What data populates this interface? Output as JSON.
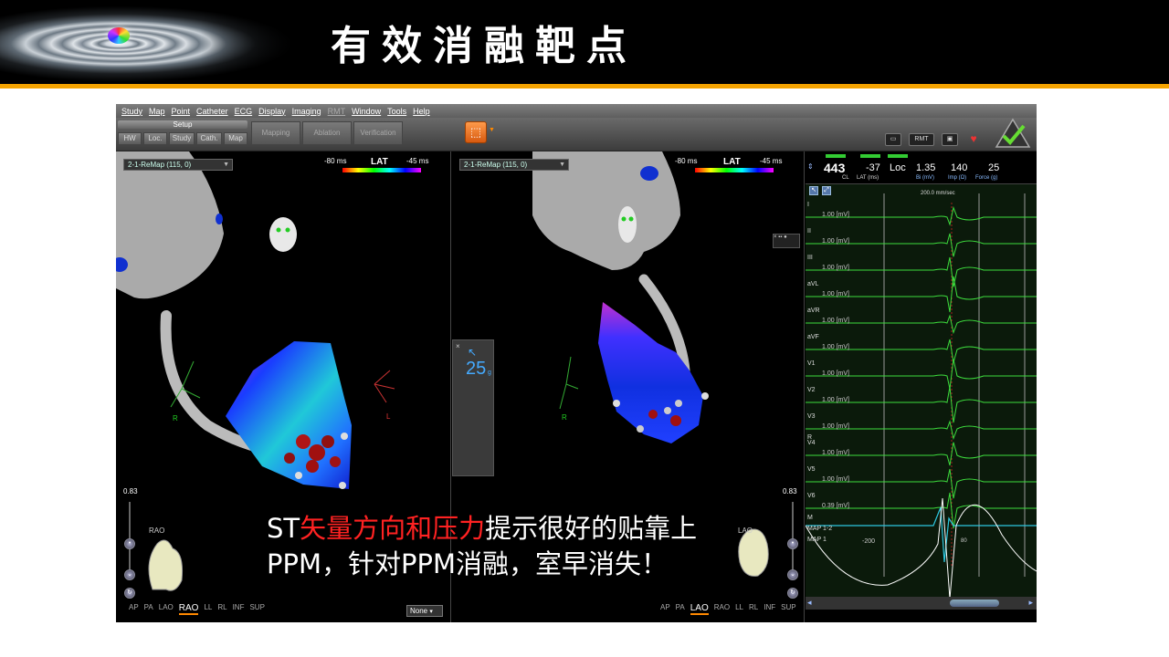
{
  "slide": {
    "title": "有效消融靶点",
    "caption": {
      "line1_prefix": "ST",
      "line1_red": "矢量方向和压力",
      "line1_suffix": "提示很好的贴靠上",
      "line2": "PPM，针对PPM消融，室早消失！"
    }
  },
  "app": {
    "menu": [
      "Study",
      "Map",
      "Point",
      "Catheter",
      "ECG",
      "Display",
      "Imaging",
      "RMT",
      "Window",
      "Tools",
      "Help"
    ],
    "menu_disabled": "RMT",
    "toolbar": {
      "setup_label": "Setup",
      "setup_tabs": [
        "HW",
        "Loc.",
        "Study",
        "Cath.",
        "Map"
      ],
      "workflow": [
        "Mapping",
        "Ablation",
        "Verification"
      ],
      "status_icons": [
        "RMT"
      ]
    },
    "left_map": {
      "map_name": "2-1-ReMap (115, 0)",
      "lat_min": "-80 ms",
      "lat_title": "LAT",
      "lat_max": "-45 ms",
      "zoom": "0.83",
      "view_label": "RAO",
      "tabs": [
        "AP",
        "PA",
        "LAO",
        "RAO",
        "LL",
        "RL",
        "INF",
        "SUP"
      ],
      "active_tab": "RAO",
      "axis_r": "R",
      "axis_l": "L",
      "overlay_select": "None"
    },
    "mid_map": {
      "map_name": "2-1-ReMap (115, 0)",
      "lat_min": "-80 ms",
      "lat_title": "LAT",
      "lat_max": "-45 ms",
      "zoom": "0.83",
      "view_label": "LAO",
      "tabs": [
        "AP",
        "PA",
        "LAO",
        "RAO",
        "LL",
        "RL",
        "INF",
        "SUP"
      ],
      "active_tab": "LAO",
      "axis_r": "R",
      "force_value": "25",
      "force_unit": "g",
      "close": "×"
    },
    "ecg": {
      "header": {
        "cl_value": "443",
        "cl_label": "CL",
        "lat_value": "-37",
        "lat_label": "LAT (ms)",
        "loc_value": "Loc",
        "bi_value": "1.35",
        "bi_label": "Bi (mV)",
        "imp_value": "140",
        "imp_label": "Imp (Ω)",
        "force_value": "25",
        "force_label": "Force (g)"
      },
      "speed": "200.0 mm/sec",
      "unit": "[mV]",
      "leads": [
        {
          "name": "I",
          "scale": "1.00"
        },
        {
          "name": "II",
          "scale": "1.00"
        },
        {
          "name": "III",
          "scale": "1.00"
        },
        {
          "name": "aVL",
          "scale": "1.00"
        },
        {
          "name": "aVR",
          "scale": "1.00"
        },
        {
          "name": "aVF",
          "scale": "1.00"
        },
        {
          "name": "V1",
          "scale": "1.00"
        },
        {
          "name": "V2",
          "scale": "1.00"
        },
        {
          "name": "V3",
          "scale": "1.00"
        },
        {
          "name": "V4",
          "scale": "1.00"
        },
        {
          "name": "V5",
          "scale": "1.00"
        },
        {
          "name": "V6",
          "scale": "0.39"
        }
      ],
      "extra_leads": [
        "M",
        "MAP 1-2",
        "MAP 1"
      ],
      "marker_r": "R",
      "bottom_left": "-200",
      "bottom_right": "80"
    }
  },
  "colors": {
    "accent": "#f5a300",
    "caption_red": "#ff2222",
    "ecg_green": "#3ddc3d",
    "ecg_cyan": "#2ec8e0"
  }
}
